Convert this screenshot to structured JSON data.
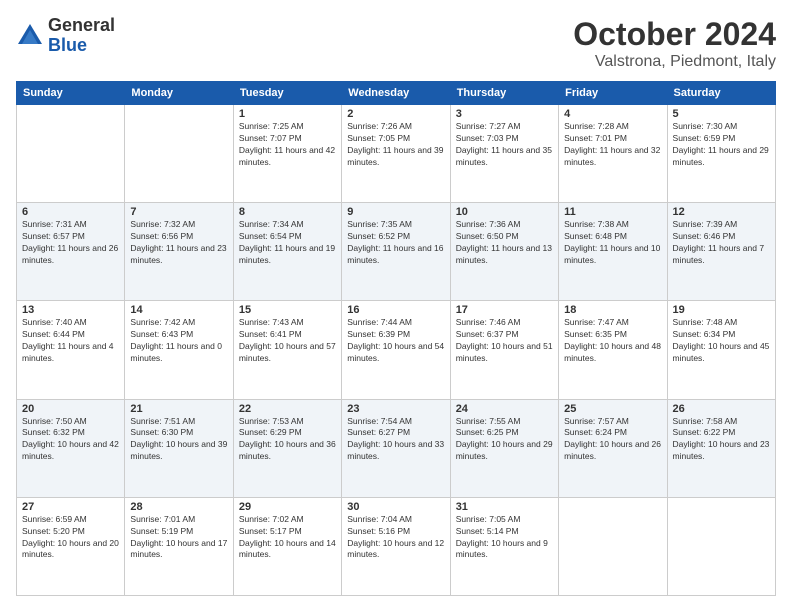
{
  "logo": {
    "general": "General",
    "blue": "Blue"
  },
  "header": {
    "month": "October 2024",
    "location": "Valstrona, Piedmont, Italy"
  },
  "weekdays": [
    "Sunday",
    "Monday",
    "Tuesday",
    "Wednesday",
    "Thursday",
    "Friday",
    "Saturday"
  ],
  "weeks": [
    [
      {
        "day": "",
        "content": ""
      },
      {
        "day": "",
        "content": ""
      },
      {
        "day": "1",
        "content": "Sunrise: 7:25 AM\nSunset: 7:07 PM\nDaylight: 11 hours and 42 minutes."
      },
      {
        "day": "2",
        "content": "Sunrise: 7:26 AM\nSunset: 7:05 PM\nDaylight: 11 hours and 39 minutes."
      },
      {
        "day": "3",
        "content": "Sunrise: 7:27 AM\nSunset: 7:03 PM\nDaylight: 11 hours and 35 minutes."
      },
      {
        "day": "4",
        "content": "Sunrise: 7:28 AM\nSunset: 7:01 PM\nDaylight: 11 hours and 32 minutes."
      },
      {
        "day": "5",
        "content": "Sunrise: 7:30 AM\nSunset: 6:59 PM\nDaylight: 11 hours and 29 minutes."
      }
    ],
    [
      {
        "day": "6",
        "content": "Sunrise: 7:31 AM\nSunset: 6:57 PM\nDaylight: 11 hours and 26 minutes."
      },
      {
        "day": "7",
        "content": "Sunrise: 7:32 AM\nSunset: 6:56 PM\nDaylight: 11 hours and 23 minutes."
      },
      {
        "day": "8",
        "content": "Sunrise: 7:34 AM\nSunset: 6:54 PM\nDaylight: 11 hours and 19 minutes."
      },
      {
        "day": "9",
        "content": "Sunrise: 7:35 AM\nSunset: 6:52 PM\nDaylight: 11 hours and 16 minutes."
      },
      {
        "day": "10",
        "content": "Sunrise: 7:36 AM\nSunset: 6:50 PM\nDaylight: 11 hours and 13 minutes."
      },
      {
        "day": "11",
        "content": "Sunrise: 7:38 AM\nSunset: 6:48 PM\nDaylight: 11 hours and 10 minutes."
      },
      {
        "day": "12",
        "content": "Sunrise: 7:39 AM\nSunset: 6:46 PM\nDaylight: 11 hours and 7 minutes."
      }
    ],
    [
      {
        "day": "13",
        "content": "Sunrise: 7:40 AM\nSunset: 6:44 PM\nDaylight: 11 hours and 4 minutes."
      },
      {
        "day": "14",
        "content": "Sunrise: 7:42 AM\nSunset: 6:43 PM\nDaylight: 11 hours and 0 minutes."
      },
      {
        "day": "15",
        "content": "Sunrise: 7:43 AM\nSunset: 6:41 PM\nDaylight: 10 hours and 57 minutes."
      },
      {
        "day": "16",
        "content": "Sunrise: 7:44 AM\nSunset: 6:39 PM\nDaylight: 10 hours and 54 minutes."
      },
      {
        "day": "17",
        "content": "Sunrise: 7:46 AM\nSunset: 6:37 PM\nDaylight: 10 hours and 51 minutes."
      },
      {
        "day": "18",
        "content": "Sunrise: 7:47 AM\nSunset: 6:35 PM\nDaylight: 10 hours and 48 minutes."
      },
      {
        "day": "19",
        "content": "Sunrise: 7:48 AM\nSunset: 6:34 PM\nDaylight: 10 hours and 45 minutes."
      }
    ],
    [
      {
        "day": "20",
        "content": "Sunrise: 7:50 AM\nSunset: 6:32 PM\nDaylight: 10 hours and 42 minutes."
      },
      {
        "day": "21",
        "content": "Sunrise: 7:51 AM\nSunset: 6:30 PM\nDaylight: 10 hours and 39 minutes."
      },
      {
        "day": "22",
        "content": "Sunrise: 7:53 AM\nSunset: 6:29 PM\nDaylight: 10 hours and 36 minutes."
      },
      {
        "day": "23",
        "content": "Sunrise: 7:54 AM\nSunset: 6:27 PM\nDaylight: 10 hours and 33 minutes."
      },
      {
        "day": "24",
        "content": "Sunrise: 7:55 AM\nSunset: 6:25 PM\nDaylight: 10 hours and 29 minutes."
      },
      {
        "day": "25",
        "content": "Sunrise: 7:57 AM\nSunset: 6:24 PM\nDaylight: 10 hours and 26 minutes."
      },
      {
        "day": "26",
        "content": "Sunrise: 7:58 AM\nSunset: 6:22 PM\nDaylight: 10 hours and 23 minutes."
      }
    ],
    [
      {
        "day": "27",
        "content": "Sunrise: 6:59 AM\nSunset: 5:20 PM\nDaylight: 10 hours and 20 minutes."
      },
      {
        "day": "28",
        "content": "Sunrise: 7:01 AM\nSunset: 5:19 PM\nDaylight: 10 hours and 17 minutes."
      },
      {
        "day": "29",
        "content": "Sunrise: 7:02 AM\nSunset: 5:17 PM\nDaylight: 10 hours and 14 minutes."
      },
      {
        "day": "30",
        "content": "Sunrise: 7:04 AM\nSunset: 5:16 PM\nDaylight: 10 hours and 12 minutes."
      },
      {
        "day": "31",
        "content": "Sunrise: 7:05 AM\nSunset: 5:14 PM\nDaylight: 10 hours and 9 minutes."
      },
      {
        "day": "",
        "content": ""
      },
      {
        "day": "",
        "content": ""
      }
    ]
  ]
}
